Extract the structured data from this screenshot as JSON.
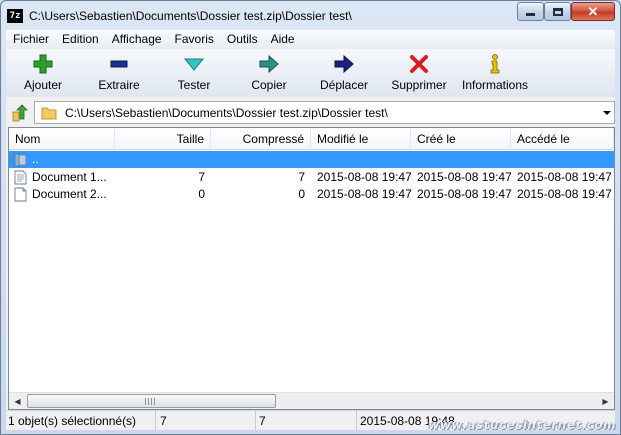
{
  "window": {
    "app_icon_text": "7z",
    "title": "C:\\Users\\Sebastien\\Documents\\Dossier test.zip\\Dossier test\\",
    "close_glyph": "✕"
  },
  "menu": {
    "items": [
      "Fichier",
      "Edition",
      "Affichage",
      "Favoris",
      "Outils",
      "Aide"
    ]
  },
  "toolbar": {
    "buttons": [
      {
        "label": "Ajouter",
        "icon": "plus-icon",
        "color": "#2ca02c"
      },
      {
        "label": "Extraire",
        "icon": "minus-icon",
        "color": "#1a2f8f"
      },
      {
        "label": "Tester",
        "icon": "check-arrow-icon",
        "color": "#35c4c4"
      },
      {
        "label": "Copier",
        "icon": "copy-arrow-icon",
        "color": "#2e8c8c"
      },
      {
        "label": "Déplacer",
        "icon": "move-arrow-icon",
        "color": "#1a237e"
      },
      {
        "label": "Supprimer",
        "icon": "delete-x-icon",
        "color": "#d81f1f"
      },
      {
        "label": "Informations",
        "icon": "info-icon",
        "color": "#e6c200"
      }
    ]
  },
  "address": {
    "path": "C:\\Users\\Sebastien\\Documents\\Dossier test.zip\\Dossier test\\"
  },
  "list": {
    "columns": [
      "Nom",
      "Taille",
      "Compressé",
      "Modifié le",
      "Créé le",
      "Accédé le"
    ],
    "rows": [
      {
        "name": "..",
        "size": "",
        "packed": "",
        "modified": "",
        "created": "",
        "accessed": "",
        "icon": "folder-icon",
        "selected": true
      },
      {
        "name": "Document 1...",
        "size": "7",
        "packed": "7",
        "modified": "2015-08-08 19:47",
        "created": "2015-08-08 19:47",
        "accessed": "2015-08-08 19:47",
        "icon": "document-icon",
        "selected": false
      },
      {
        "name": "Document 2...",
        "size": "0",
        "packed": "0",
        "modified": "2015-08-08 19:47",
        "created": "2015-08-08 19:47",
        "accessed": "2015-08-08 19:47",
        "icon": "document-icon",
        "selected": false
      }
    ]
  },
  "scrollbar": {
    "left_arrow": "◀",
    "right_arrow": "▶"
  },
  "status": {
    "selection": "1 objet(s) sélectionné(s)",
    "size": "7",
    "packed": "7",
    "date": "2015-08-08 19:48"
  },
  "watermark": "www.astucesinternet.com"
}
